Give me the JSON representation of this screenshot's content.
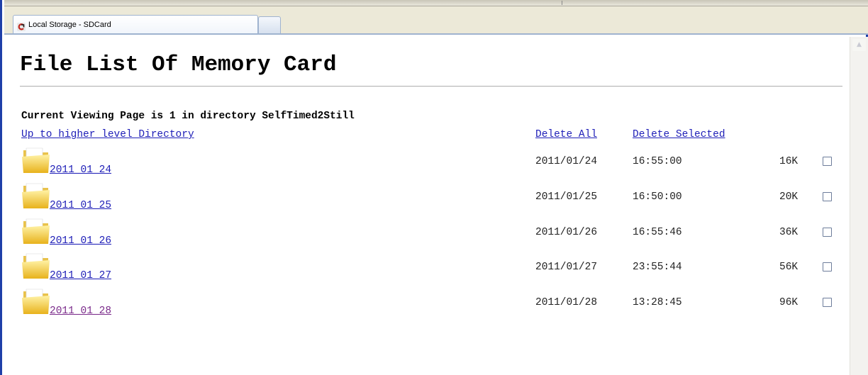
{
  "tab": {
    "title": "Local Storage - SDCard",
    "icon": "storage-app-icon"
  },
  "page": {
    "heading": "File List Of Memory Card",
    "status_line": "Current Viewing Page is 1 in directory SelfTimed2Still",
    "up_link": "Up to higher level Directory",
    "delete_all": "Delete All",
    "delete_selected": "Delete Selected"
  },
  "files": [
    {
      "name": "2011_01_24",
      "date": "2011/01/24",
      "time": "16:55:00",
      "size": "16K",
      "visited": false,
      "checked": false
    },
    {
      "name": "2011_01_25",
      "date": "2011/01/25",
      "time": "16:50:00",
      "size": "20K",
      "visited": false,
      "checked": false
    },
    {
      "name": "2011_01_26",
      "date": "2011/01/26",
      "time": "16:55:46",
      "size": "36K",
      "visited": false,
      "checked": false
    },
    {
      "name": "2011_01_27",
      "date": "2011/01/27",
      "time": "23:55:44",
      "size": "56K",
      "visited": false,
      "checked": false
    },
    {
      "name": "2011_01_28",
      "date": "2011/01/28",
      "time": "13:28:45",
      "size": "96K",
      "visited": true,
      "checked": false
    }
  ],
  "colors": {
    "link": "#2020b8",
    "visited_link": "#7b2c8b",
    "window_border": "#1f3fa8"
  }
}
